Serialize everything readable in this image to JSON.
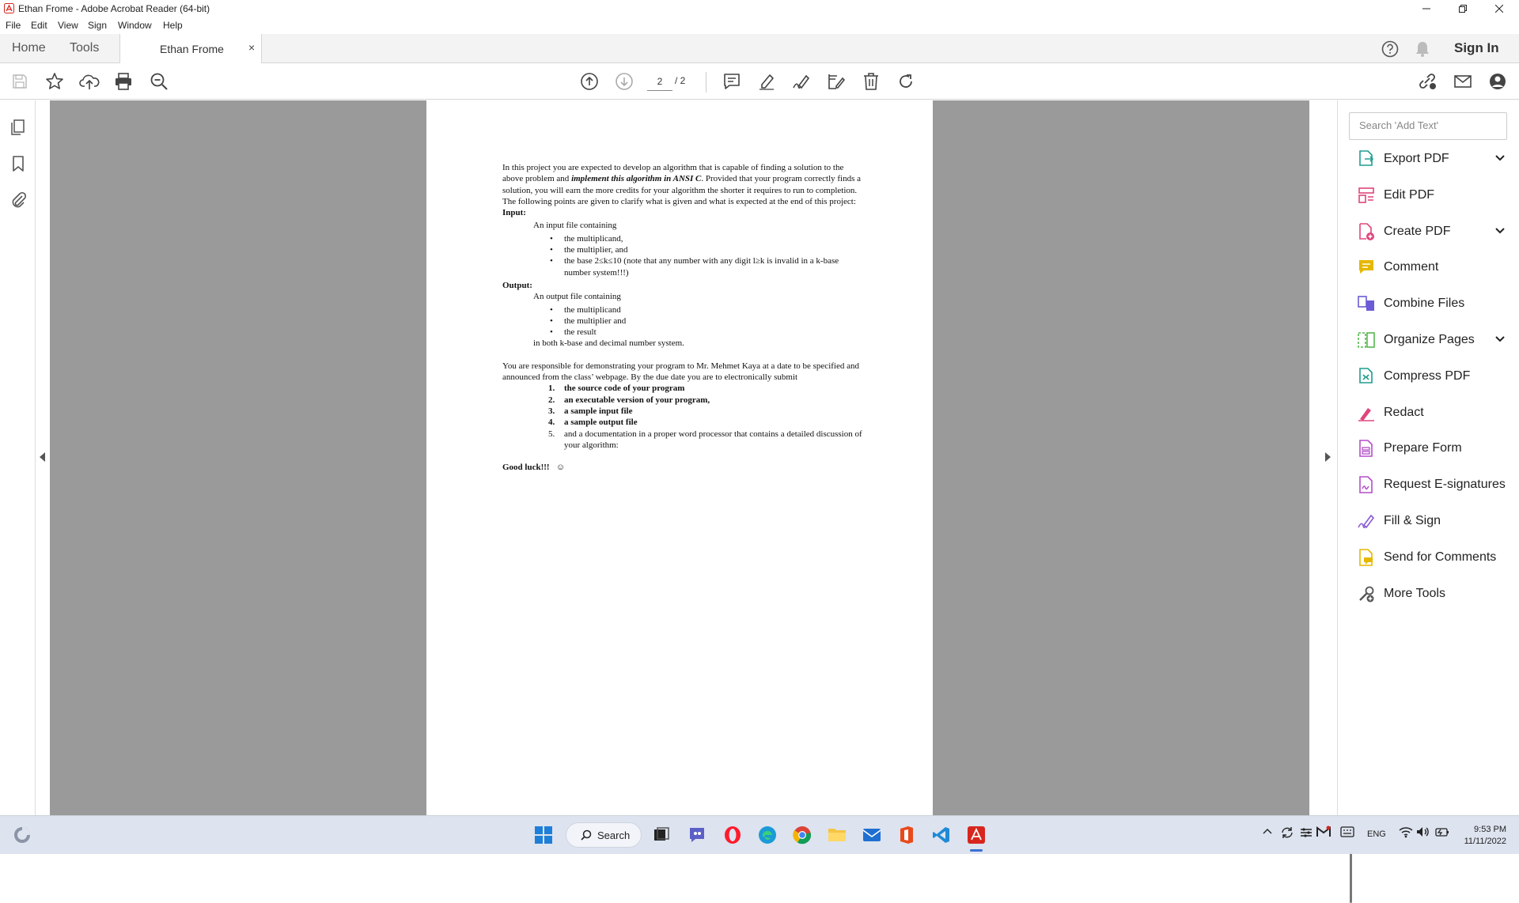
{
  "window": {
    "title": "Ethan Frome - Adobe Acrobat Reader (64-bit)"
  },
  "menu": [
    "File",
    "Edit",
    "View",
    "Sign",
    "Window",
    "Help"
  ],
  "tabs": {
    "home": "Home",
    "tools": "Tools",
    "document": "Ethan Frome",
    "close": "×",
    "sign_in": "Sign In"
  },
  "toolbar": {
    "current_page": "2",
    "page_total": "/ 2"
  },
  "document": {
    "para1_a": "In this project you are expected to develop an algorithm that is capable of finding a solution to the above problem and ",
    "para1_em": "implement this algorithm in ANSI C",
    "para1_b": ".  Provided that your program correctly finds a solution, you will earn the more credits for your algorithm the shorter it requires to run to completion.  The following points are given to clarify what is given and what is expected at the end of this project:",
    "input_heading": "Input:",
    "input_intro": "An input file containing",
    "input_items": [
      "the multiplicand,",
      "the multiplier, and",
      "the base 2≤k≤10 (note that any number with any digit l≥k is invalid in a k-base number system!!!)"
    ],
    "output_heading": "Output:",
    "output_intro": "An output file containing",
    "output_items": [
      "the multiplicand",
      "the multiplier and",
      "the result"
    ],
    "output_outro": "in both k-base and decimal number system.",
    "para2": "You are responsible for demonstrating your program to Mr. Mehmet Kaya at a date to be specified and announced from the class’ webpage.  By the due date you are to electronically submit",
    "submit_items": [
      {
        "num": "1.",
        "text": "the source code of your program"
      },
      {
        "num": "2.",
        "text": "an executable version of your program,"
      },
      {
        "num": "3.",
        "text": "a sample input file"
      },
      {
        "num": "4.",
        "text": "a sample output file"
      },
      {
        "num": "5.",
        "text": "and a documentation in a proper word processor that contains a detailed discussion of your algorithm:"
      }
    ],
    "closing": "Good luck!!!",
    "smiley": "☺"
  },
  "right_panel": {
    "search_placeholder": "Search 'Add Text'",
    "tools": [
      {
        "label": "Export PDF",
        "icon": "export-pdf-icon",
        "color": "#1f9d8f",
        "expandable": true
      },
      {
        "label": "Edit PDF",
        "icon": "edit-pdf-icon",
        "color": "#e0457b",
        "expandable": false
      },
      {
        "label": "Create PDF",
        "icon": "create-pdf-icon",
        "color": "#e0457b",
        "expandable": true
      },
      {
        "label": "Comment",
        "icon": "comment-icon",
        "color": "#e5b800",
        "expandable": false
      },
      {
        "label": "Combine Files",
        "icon": "combine-files-icon",
        "color": "#6b5bd6",
        "expandable": false
      },
      {
        "label": "Organize Pages",
        "icon": "organize-pages-icon",
        "color": "#57b84f",
        "expandable": true
      },
      {
        "label": "Compress PDF",
        "icon": "compress-pdf-icon",
        "color": "#1f9d8f",
        "expandable": false
      },
      {
        "label": "Redact",
        "icon": "redact-icon",
        "color": "#e0457b",
        "expandable": false
      },
      {
        "label": "Prepare Form",
        "icon": "prepare-form-icon",
        "color": "#b44fc8",
        "expandable": false
      },
      {
        "label": "Request E-signatures",
        "icon": "request-esignatures-icon",
        "color": "#b44fc8",
        "expandable": false
      },
      {
        "label": "Fill & Sign",
        "icon": "fill-sign-icon",
        "color": "#8a5bd6",
        "expandable": false
      },
      {
        "label": "Send for Comments",
        "icon": "send-for-comments-icon",
        "color": "#e5b800",
        "expandable": false
      },
      {
        "label": "More Tools",
        "icon": "more-tools-icon",
        "color": "#555555",
        "expandable": false
      }
    ]
  },
  "taskbar": {
    "search_label": "Search",
    "language": "ENG",
    "time": "9:53 PM",
    "date": "11/11/2022"
  },
  "colors": {
    "accent": "#d7261e",
    "doc_background": "#9a9a9a",
    "taskbar": "#dde3ef"
  }
}
